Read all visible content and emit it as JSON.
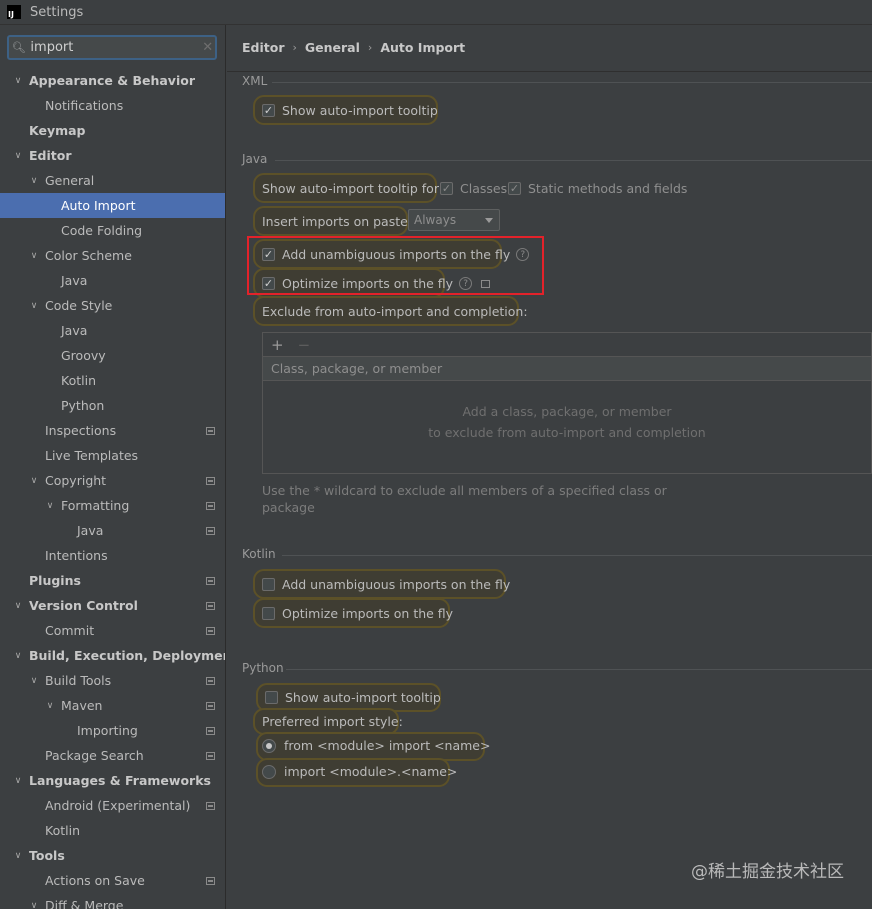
{
  "window": {
    "app_icon": "IJ",
    "title": "Settings"
  },
  "search": {
    "value": "import"
  },
  "tree": [
    {
      "label": "Appearance & Behavior",
      "level": 0,
      "bold": true,
      "chev": "down"
    },
    {
      "label": "Notifications",
      "level": 1
    },
    {
      "label": "Keymap",
      "level": 0,
      "bold": true
    },
    {
      "label": "Editor",
      "level": 0,
      "bold": true,
      "chev": "down"
    },
    {
      "label": "General",
      "level": 1,
      "chev": "down"
    },
    {
      "label": "Auto Import",
      "level": 2,
      "selected": true
    },
    {
      "label": "Code Folding",
      "level": 2
    },
    {
      "label": "Color Scheme",
      "level": 1,
      "chev": "down"
    },
    {
      "label": "Java",
      "level": 2
    },
    {
      "label": "Code Style",
      "level": 1,
      "chev": "down"
    },
    {
      "label": "Java",
      "level": 2
    },
    {
      "label": "Groovy",
      "level": 2
    },
    {
      "label": "Kotlin",
      "level": 2
    },
    {
      "label": "Python",
      "level": 2
    },
    {
      "label": "Inspections",
      "level": 1,
      "proj": true
    },
    {
      "label": "Live Templates",
      "level": 1
    },
    {
      "label": "Copyright",
      "level": 1,
      "chev": "down",
      "proj": true
    },
    {
      "label": "Formatting",
      "level": 2,
      "chev": "down",
      "proj": true
    },
    {
      "label": "Java",
      "level": 3,
      "proj": true
    },
    {
      "label": "Intentions",
      "level": 1
    },
    {
      "label": "Plugins",
      "level": 0,
      "bold": true,
      "proj": true
    },
    {
      "label": "Version Control",
      "level": 0,
      "bold": true,
      "chev": "down",
      "proj": true
    },
    {
      "label": "Commit",
      "level": 1,
      "proj": true
    },
    {
      "label": "Build, Execution, Deployment",
      "level": 0,
      "bold": true,
      "chev": "down"
    },
    {
      "label": "Build Tools",
      "level": 1,
      "chev": "down",
      "proj": true
    },
    {
      "label": "Maven",
      "level": 2,
      "chev": "down",
      "proj": true
    },
    {
      "label": "Importing",
      "level": 3,
      "proj": true
    },
    {
      "label": "Package Search",
      "level": 1,
      "proj": true
    },
    {
      "label": "Languages & Frameworks",
      "level": 0,
      "bold": true,
      "chev": "down"
    },
    {
      "label": "Android (Experimental)",
      "level": 1,
      "proj": true
    },
    {
      "label": "Kotlin",
      "level": 1
    },
    {
      "label": "Tools",
      "level": 0,
      "bold": true,
      "chev": "down"
    },
    {
      "label": "Actions on Save",
      "level": 1,
      "proj": true
    },
    {
      "label": "Diff & Merge",
      "level": 1,
      "chev": "down"
    }
  ],
  "breadcrumb": [
    "Editor",
    "General",
    "Auto Import"
  ],
  "xml": {
    "title": "XML",
    "show_tooltip": "Show auto-import tooltip"
  },
  "java": {
    "title": "Java",
    "show_tooltip_for": "Show auto-import tooltip for:",
    "classes": "Classes",
    "static_methods": "Static methods and fields",
    "insert_on_paste": "Insert imports on paste:",
    "insert_on_paste_value": "Always",
    "add_unambiguous": "Add unambiguous imports on the fly",
    "optimize": "Optimize imports on the fly",
    "exclude": "Exclude from auto-import and completion:",
    "exclude_add": "+",
    "exclude_remove": "−",
    "exclude_column": "Class, package, or member",
    "exclude_empty_1": "Add a class, package, or member",
    "exclude_empty_2": "to exclude from auto-import and completion",
    "hint": "Use the * wildcard to exclude all members of a specified class or package"
  },
  "kotlin": {
    "title": "Kotlin",
    "add_unambiguous": "Add unambiguous imports on the fly",
    "optimize": "Optimize imports on the fly"
  },
  "python": {
    "title": "Python",
    "show_tooltip": "Show auto-import tooltip",
    "preferred_style": "Preferred import style:",
    "option_from": "from <module> import <name>",
    "option_import": "import <module>.<name>"
  },
  "watermark": "@稀土掘金技术社区",
  "colors": {
    "selection": "#4b6eaf",
    "highlight_border": "#5c5128",
    "annotation_box": "#e3222a"
  }
}
